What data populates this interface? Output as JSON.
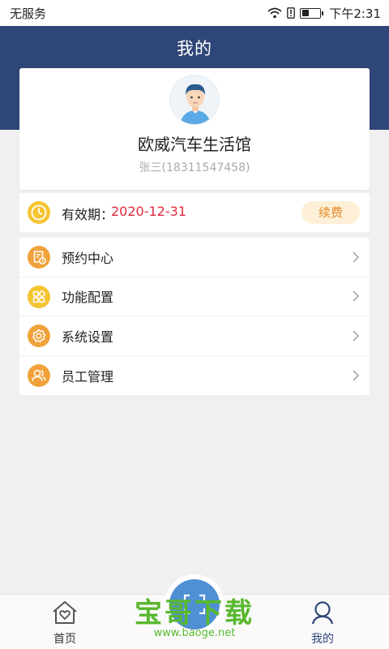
{
  "status_bar": {
    "carrier": "无服务",
    "time": "下午2:31"
  },
  "header": {
    "title": "我的"
  },
  "profile": {
    "shop_name": "欧威汽车生活馆",
    "owner": "张三(18311547458)"
  },
  "validity": {
    "label": "有效期：",
    "date": "2020-12-31",
    "renew_label": "续费"
  },
  "menu": {
    "items": [
      {
        "label": "预约中心",
        "icon": "calendar-note-icon"
      },
      {
        "label": "功能配置",
        "icon": "grid-config-icon"
      },
      {
        "label": "系统设置",
        "icon": "gear-icon"
      },
      {
        "label": "员工管理",
        "icon": "people-icon"
      }
    ]
  },
  "bottom_nav": {
    "home_label": "首页",
    "mine_label": "我的"
  },
  "watermark": {
    "title": "宝哥下载",
    "url": "www.baoge.net"
  },
  "colors": {
    "header_bg": "#2f4679",
    "accent_red": "#e0283e",
    "icon_orange": "#f0a23a",
    "icon_yellow": "#f5c431",
    "renew_bg": "#fdf0d6",
    "scan_blue": "#4f8fd4",
    "watermark_green": "#59b82e"
  }
}
